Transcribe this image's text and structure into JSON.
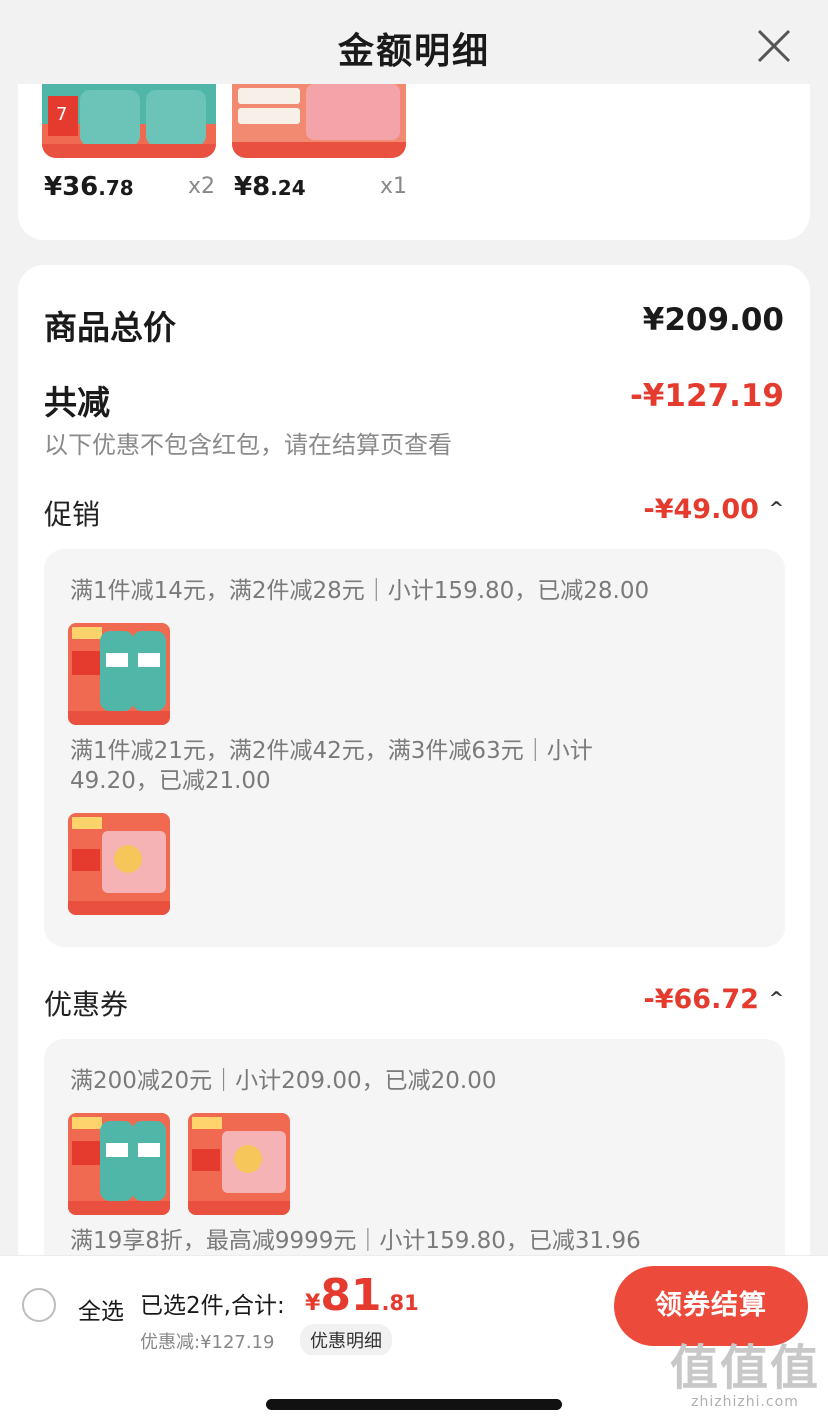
{
  "header": {
    "title": "金额明细"
  },
  "top_items": [
    {
      "price_int": "¥36",
      "price_dec": ".78",
      "qty": "x2"
    },
    {
      "price_int": "¥8",
      "price_dec": ".24",
      "qty": "x1"
    }
  ],
  "summary": {
    "total_label": "商品总价",
    "total_value": "¥209.00",
    "reduce_label": "共减",
    "reduce_value": "-¥127.19",
    "note": "以下优惠不包含红包，请在结算页查看"
  },
  "promotion": {
    "label": "促销",
    "value": "-¥49.00",
    "caret": "^",
    "lines": [
      "满1件减14元，满2件减28元｜小计159.80，已减28.00",
      "满1件减21元，满2件减42元，满3件减63元｜小计",
      "49.20，已减21.00"
    ]
  },
  "coupon": {
    "label": "优惠券",
    "value": "-¥66.72",
    "caret": "^",
    "lines": [
      "满200减20元｜小计209.00，已减20.00",
      "满19享8折，最高减9999元｜小计159.80，已减31.96"
    ]
  },
  "bottom_bar": {
    "select_all": "全选",
    "selected_text": "已选2件,合计:",
    "total_yen": "¥",
    "total_int": "81",
    "total_dec": ".81",
    "discount_text": "优惠减:¥127.19",
    "detail_link": "优惠明细",
    "checkout": "领券结算"
  },
  "watermark": {
    "big": "值值值",
    "small": "zhizhizhi.com"
  },
  "colors": {
    "accent": "#e43b2e",
    "checkout_bg": "#ec4a3b",
    "page_bg": "#f2f2f2"
  },
  "icons": {
    "close": "close-icon",
    "caret": "caret-up-icon",
    "radio": "radio-unchecked-icon"
  }
}
